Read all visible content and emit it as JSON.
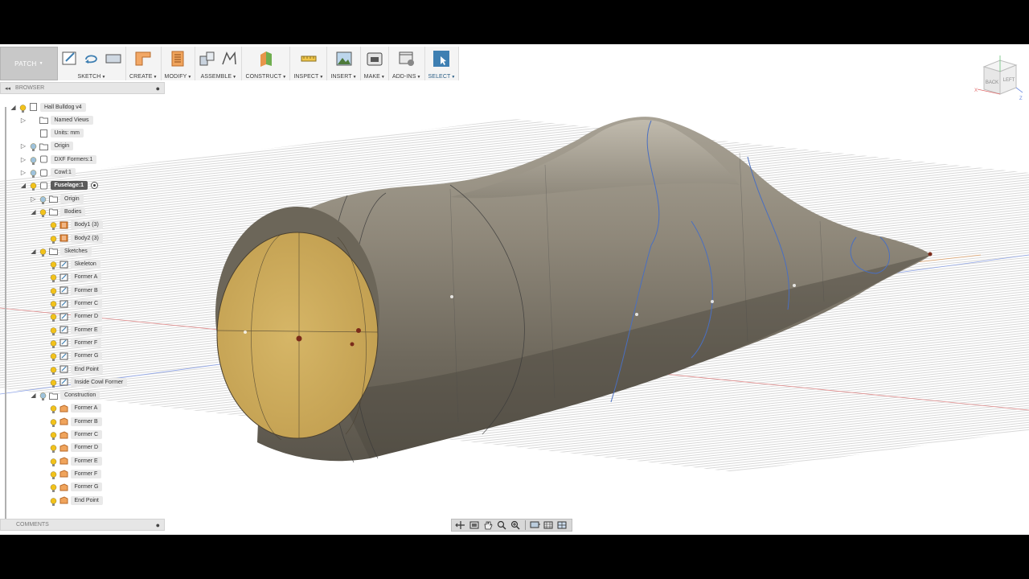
{
  "workspace": {
    "label": "PATCH"
  },
  "toolbar": [
    {
      "id": "sketch",
      "label": "SKETCH",
      "icons": [
        "create-sketch-icon",
        "undo-arrow-icon",
        "rectangle-icon"
      ]
    },
    {
      "id": "create",
      "label": "CREATE",
      "icons": [
        "create-patch-icon"
      ]
    },
    {
      "id": "modify",
      "label": "MODIFY",
      "icons": [
        "modify-icon"
      ]
    },
    {
      "id": "assemble",
      "label": "ASSEMBLE",
      "icons": [
        "new-component-icon",
        "joint-icon"
      ]
    },
    {
      "id": "construct",
      "label": "CONSTRUCT",
      "icons": [
        "offset-plane-icon"
      ]
    },
    {
      "id": "inspect",
      "label": "INSPECT",
      "icons": [
        "measure-icon"
      ]
    },
    {
      "id": "insert",
      "label": "INSERT",
      "icons": [
        "insert-image-icon"
      ]
    },
    {
      "id": "make",
      "label": "MAKE",
      "icons": [
        "3d-print-icon"
      ]
    },
    {
      "id": "addins",
      "label": "ADD-INS",
      "icons": [
        "scripts-addins-icon"
      ]
    },
    {
      "id": "select",
      "label": "SELECT",
      "icons": [
        "select-cursor-icon"
      ]
    }
  ],
  "browser": {
    "title": "BROWSER",
    "items": [
      {
        "label": "Hall Bulldog v4",
        "level": 0,
        "arrow": "open",
        "icon": "document"
      },
      {
        "label": "Named Views",
        "level": 1,
        "arrow": "closed",
        "icon": "folder",
        "nobulb": true
      },
      {
        "label": "Units: mm",
        "level": 1,
        "arrow": "none",
        "icon": "document",
        "nobulb": true
      },
      {
        "label": "Origin",
        "level": 1,
        "arrow": "closed",
        "icon": "folder"
      },
      {
        "label": "DXF Formers:1",
        "level": 1,
        "arrow": "closed",
        "icon": "component"
      },
      {
        "label": "Cowl:1",
        "level": 1,
        "arrow": "closed",
        "icon": "component"
      },
      {
        "label": "Fuselage:1",
        "level": 1,
        "arrow": "open",
        "icon": "component",
        "selected": true
      },
      {
        "label": "Origin",
        "level": 2,
        "arrow": "closed",
        "icon": "folder"
      },
      {
        "label": "Bodies",
        "level": 2,
        "arrow": "open",
        "icon": "folder"
      },
      {
        "label": "Body1 (3)",
        "level": 3,
        "arrow": "none",
        "icon": "body"
      },
      {
        "label": "Body2 (3)",
        "level": 3,
        "arrow": "none",
        "icon": "body"
      },
      {
        "label": "Sketches",
        "level": 2,
        "arrow": "open",
        "icon": "folder"
      },
      {
        "label": "Skeleton",
        "level": 3,
        "arrow": "none",
        "icon": "sketch"
      },
      {
        "label": "Former A",
        "level": 3,
        "arrow": "none",
        "icon": "sketch"
      },
      {
        "label": "Former B",
        "level": 3,
        "arrow": "none",
        "icon": "sketch"
      },
      {
        "label": "Former C",
        "level": 3,
        "arrow": "none",
        "icon": "sketch"
      },
      {
        "label": "Former D",
        "level": 3,
        "arrow": "none",
        "icon": "sketch"
      },
      {
        "label": "Former E",
        "level": 3,
        "arrow": "none",
        "icon": "sketch"
      },
      {
        "label": "Former F",
        "level": 3,
        "arrow": "none",
        "icon": "sketch"
      },
      {
        "label": "Former G",
        "level": 3,
        "arrow": "none",
        "icon": "sketch"
      },
      {
        "label": "End Point",
        "level": 3,
        "arrow": "none",
        "icon": "sketch"
      },
      {
        "label": "Inside Cowl Former",
        "level": 3,
        "arrow": "none",
        "icon": "sketch"
      },
      {
        "label": "Construction",
        "level": 2,
        "arrow": "open",
        "icon": "folder"
      },
      {
        "label": "Former A",
        "level": 3,
        "arrow": "none",
        "icon": "plane"
      },
      {
        "label": "Former B",
        "level": 3,
        "arrow": "none",
        "icon": "plane"
      },
      {
        "label": "Former C",
        "level": 3,
        "arrow": "none",
        "icon": "plane"
      },
      {
        "label": "Former D",
        "level": 3,
        "arrow": "none",
        "icon": "plane"
      },
      {
        "label": "Former E",
        "level": 3,
        "arrow": "none",
        "icon": "plane"
      },
      {
        "label": "Former F",
        "level": 3,
        "arrow": "none",
        "icon": "plane"
      },
      {
        "label": "Former G",
        "level": 3,
        "arrow": "none",
        "icon": "plane"
      },
      {
        "label": "End Point",
        "level": 3,
        "arrow": "none",
        "icon": "plane"
      }
    ]
  },
  "comments": {
    "title": "COMMENTS"
  },
  "navbar": {
    "icons": [
      "orbit-icon",
      "look-at-icon",
      "pan-hand-icon",
      "zoom-fit-icon",
      "zoom-icon",
      "display-settings-icon",
      "grid-settings-icon",
      "viewports-icon"
    ]
  },
  "viewcube": {
    "front_label": "BACK",
    "side_label": "LEFT",
    "axis_x": "X",
    "axis_z": "Z"
  },
  "colors": {
    "accent": "#3e7fb2",
    "selected": "#5b5b5b",
    "bulb": "#f2c21b",
    "body": "#e58a3c",
    "cap": "#d0ae5c",
    "surface": "#7d7566"
  }
}
